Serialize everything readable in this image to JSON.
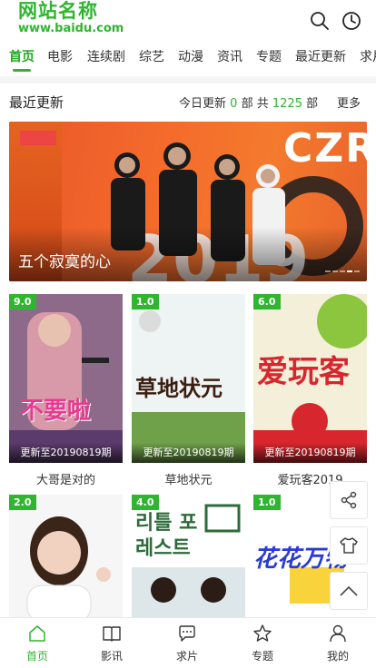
{
  "site": {
    "name": "网站名称",
    "url": "www.baidu.com"
  },
  "header": {
    "search_icon": "search-icon",
    "history_icon": "clock-icon"
  },
  "nav": {
    "items": [
      "首页",
      "电影",
      "连续剧",
      "综艺",
      "动漫",
      "资讯",
      "专题",
      "最近更新",
      "求片"
    ],
    "active": "首页"
  },
  "section": {
    "title": "最近更新",
    "today_label": "今日更新",
    "today_count": "0",
    "unit": "部",
    "total_label": "共",
    "total_count": "1225",
    "more": "更多"
  },
  "banner": {
    "caption": "五个寂寞的心",
    "art_text": "CZR",
    "year_text": "2019"
  },
  "cards": [
    {
      "score": "9.0",
      "update": "更新至20190819期",
      "title": "大哥是对的",
      "art_text": "不要啦"
    },
    {
      "score": "1.0",
      "update": "更新至20190819期",
      "title": "草地状元",
      "art_text": "草地状元"
    },
    {
      "score": "6.0",
      "update": "更新至20190819期",
      "title": "爱玩客2019",
      "art_text": "爱玩客"
    },
    {
      "score": "2.0",
      "update": "",
      "title": "",
      "art_text": ""
    },
    {
      "score": "4.0",
      "update": "",
      "title": "",
      "art_text": "리틀 포레스트"
    },
    {
      "score": "1.0",
      "update": "",
      "title": "",
      "art_text": "花花万物"
    }
  ],
  "tabbar": {
    "items": [
      {
        "label": "首页",
        "icon": "home-icon"
      },
      {
        "label": "影讯",
        "icon": "book-icon"
      },
      {
        "label": "求片",
        "icon": "chat-icon"
      },
      {
        "label": "专题",
        "icon": "star-icon"
      },
      {
        "label": "我的",
        "icon": "user-icon"
      }
    ],
    "active": "首页"
  },
  "colors": {
    "accent": "#2fb52f"
  }
}
